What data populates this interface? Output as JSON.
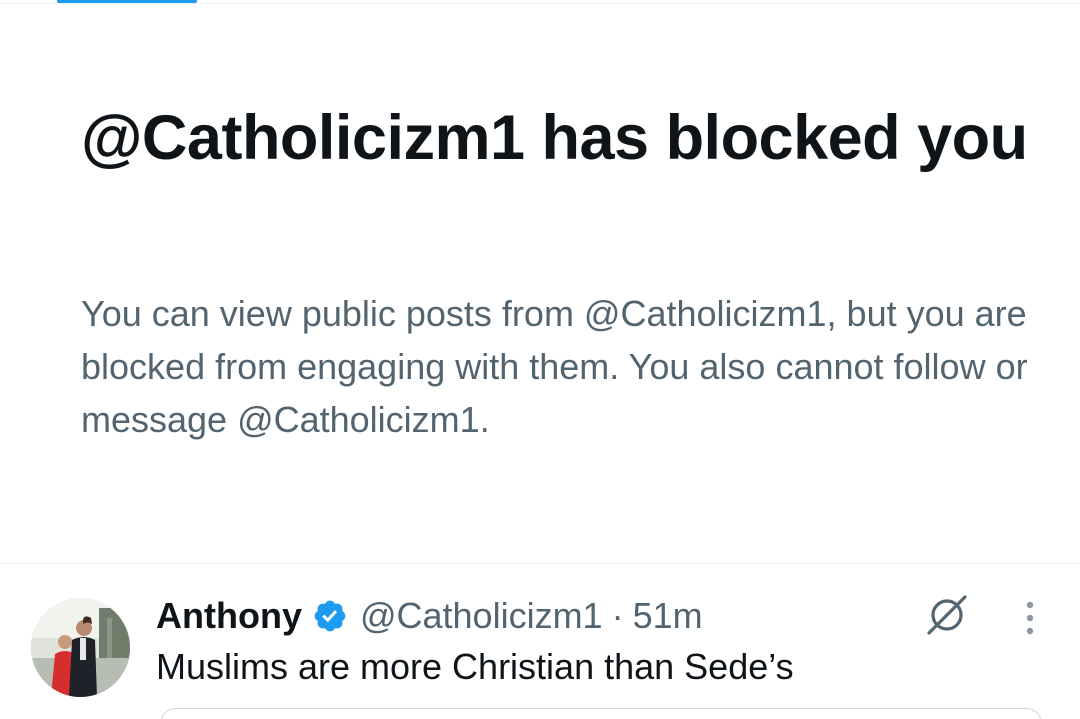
{
  "blocked_notice": {
    "title": "@Catholicizm1 has blocked you",
    "body": "You can view public posts from @Catholicizm1, but you are blocked from engaging with them. You also cannot follow or message @Catholicizm1."
  },
  "post": {
    "author_name": "Anthony",
    "handle": "@Catholicizm1",
    "separator": "·",
    "time": "51m",
    "text": "Muslims are more Christian than Sede’s",
    "verified": true,
    "avatar": "profile-photo"
  },
  "icons": {
    "verified": "verified-badge-icon",
    "grok": "grok-icon",
    "more": "more-vertical-icon"
  },
  "colors": {
    "accent": "#1d9bf0",
    "text_primary": "#0f1419",
    "text_secondary": "#536471",
    "divider": "#eff3f4",
    "background": "#ffffff"
  }
}
